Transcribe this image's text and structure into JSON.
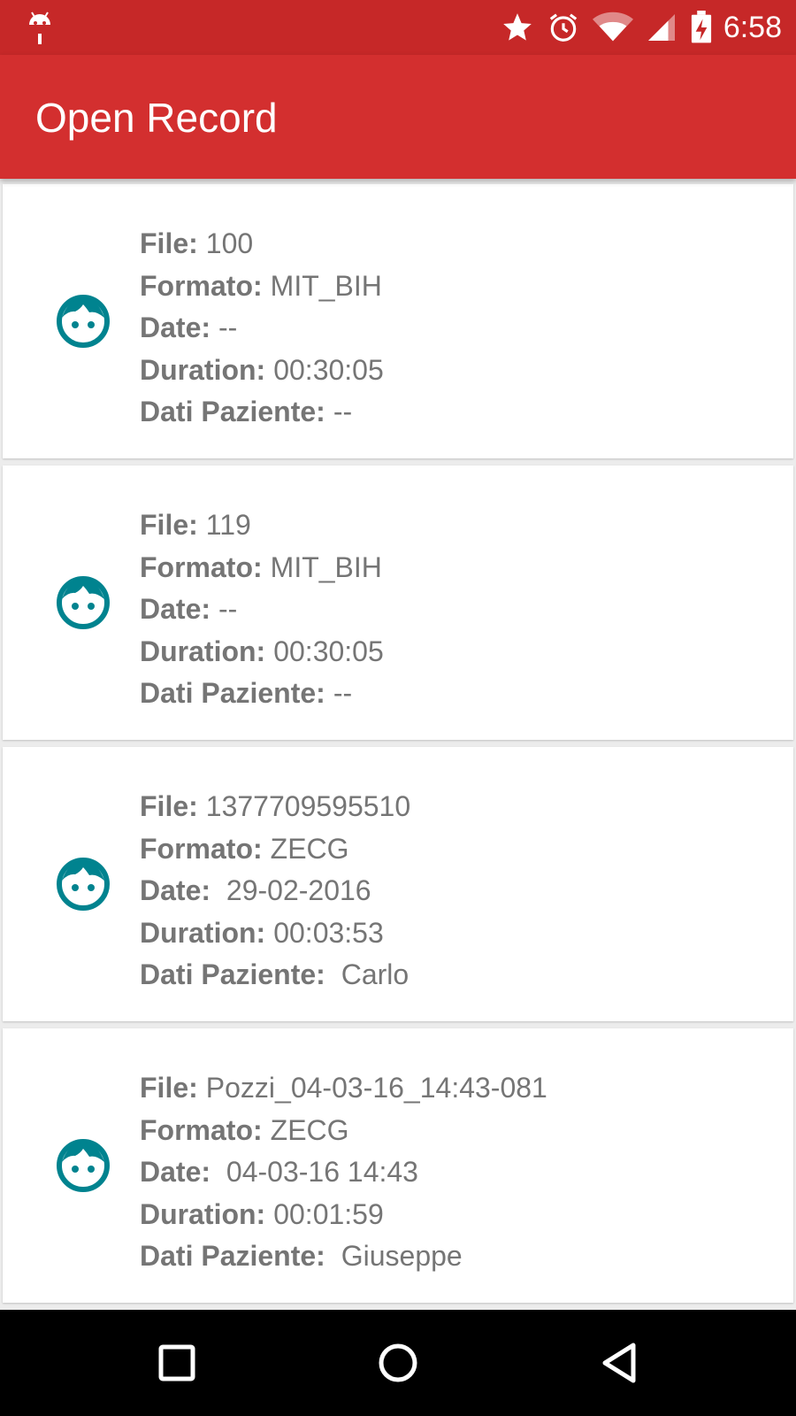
{
  "status_bar": {
    "time": "6:58",
    "icons": [
      "android-debug-icon",
      "star-icon",
      "alarm-icon",
      "wifi-icon",
      "cell-signal-icon",
      "battery-charging-icon"
    ]
  },
  "app_bar": {
    "title": "Open Record"
  },
  "labels": {
    "file": "File:",
    "format": "Formato:",
    "date": "Date:",
    "duration": "Duration:",
    "patient": "Dati Paziente:"
  },
  "records": [
    {
      "file": "100",
      "format": "MIT_BIH",
      "date": "--",
      "duration": "00:30:05",
      "patient": "--"
    },
    {
      "file": "119",
      "format": "MIT_BIH",
      "date": "--",
      "duration": "00:30:05",
      "patient": "--"
    },
    {
      "file": "1377709595510",
      "format": "ZECG",
      "date": " 29-02-2016",
      "duration": "00:03:53",
      "patient": " Carlo"
    },
    {
      "file": "Pozzi_04-03-16_14:43-081",
      "format": "ZECG",
      "date": " 04-03-16 14:43",
      "duration": "00:01:59",
      "patient": " Giuseppe"
    }
  ],
  "nav_bar": {
    "icons": [
      "recents-square-icon",
      "home-circle-icon",
      "back-triangle-icon"
    ]
  },
  "colors": {
    "status_bar": "#c62828",
    "app_bar": "#d32f2f",
    "face_icon": "#00838f",
    "text": "#757575"
  }
}
